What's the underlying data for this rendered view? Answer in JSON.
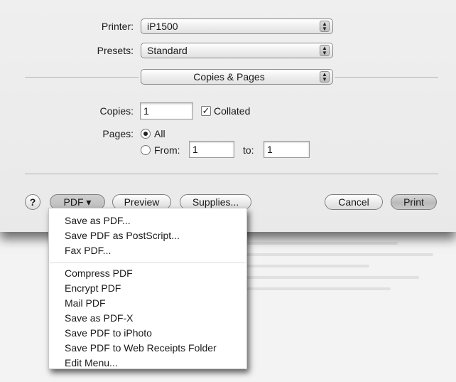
{
  "printer": {
    "label": "Printer:",
    "value": "iP1500"
  },
  "presets": {
    "label": "Presets:",
    "value": "Standard"
  },
  "panel": {
    "value": "Copies & Pages"
  },
  "copies": {
    "label": "Copies:",
    "value": "1",
    "collated_label": "Collated",
    "collated": true
  },
  "pages": {
    "label": "Pages:",
    "all_label": "All",
    "from_label": "From:",
    "from_value": "1",
    "to_label": "to:",
    "to_value": "1",
    "selected": "All"
  },
  "buttons": {
    "help": "?",
    "pdf": "PDF ▾",
    "preview": "Preview",
    "supplies": "Supplies...",
    "cancel": "Cancel",
    "print": "Print"
  },
  "pdf_menu": {
    "items": [
      "Save as PDF...",
      "Save PDF as PostScript...",
      "Fax PDF...",
      "Compress PDF",
      "Encrypt PDF",
      "Mail PDF",
      "Save as PDF-X",
      "Save PDF to iPhoto",
      "Save PDF to Web Receipts Folder",
      "Edit Menu..."
    ]
  },
  "icons": {
    "popup_arrows": "up-down-arrows-icon",
    "checkmark": "checkmark-icon"
  }
}
